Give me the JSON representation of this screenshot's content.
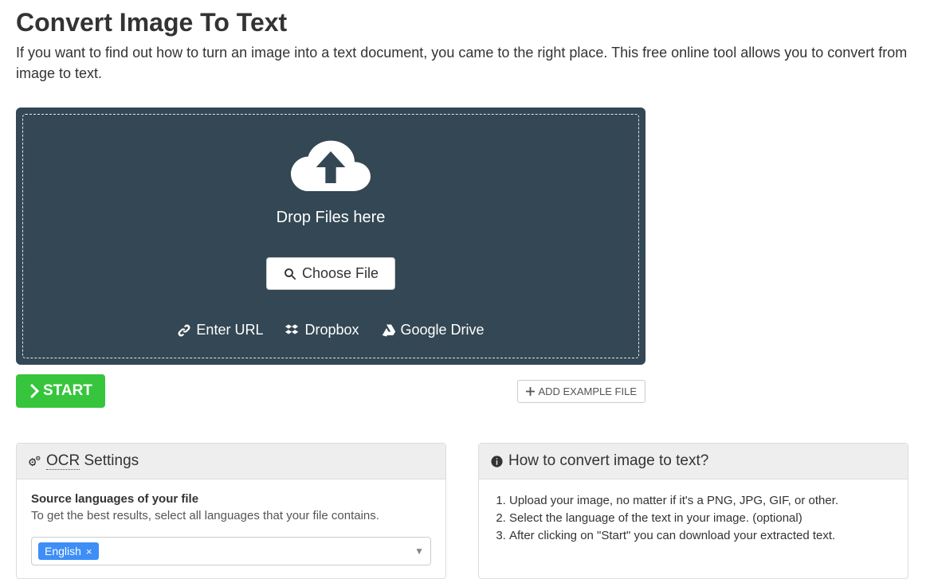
{
  "header": {
    "title": "Convert Image To Text",
    "intro": "If you want to find out how to turn an image into a text document, you came to the right place. This free online tool allows you to convert from image to text."
  },
  "dropzone": {
    "drop_label": "Drop Files here",
    "choose_label": "Choose File",
    "sources": {
      "url": "Enter URL",
      "dropbox": "Dropbox",
      "gdrive": "Google Drive"
    }
  },
  "actions": {
    "start": "START",
    "add_example": "ADD EXAMPLE FILE"
  },
  "ocr": {
    "panel_title_prefix": "OCR",
    "panel_title_suffix": " Settings",
    "source_label": "Source languages of your file",
    "source_help": "To get the best results, select all languages that your file contains.",
    "selected_language": "English"
  },
  "howto": {
    "title": "How to convert image to text?",
    "steps": [
      "Upload your image, no matter if it's a PNG, JPG, GIF, or other.",
      "Select the language of the text in your image. (optional)",
      "After clicking on \"Start\" you can download your extracted text."
    ]
  }
}
